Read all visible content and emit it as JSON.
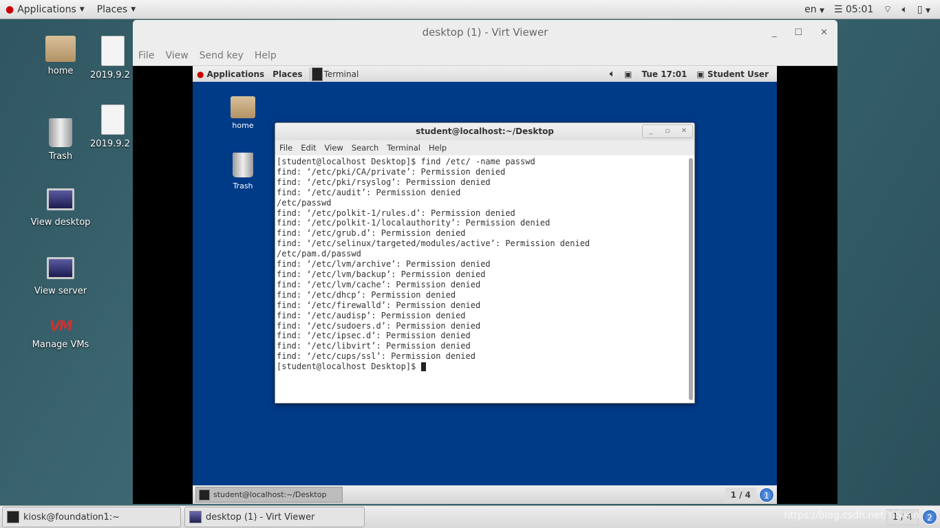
{
  "topbar": {
    "applications": "Applications",
    "places": "Places",
    "lang": "en",
    "time": "05:01"
  },
  "desktop_icons": [
    {
      "label": "home"
    },
    {
      "label": "2019.9.2"
    },
    {
      "label": "Trash"
    },
    {
      "label": "2019.9.2"
    },
    {
      "label": "View desktop"
    },
    {
      "label": "View server"
    },
    {
      "label": "Manage VMs",
      "logo": "VM"
    }
  ],
  "virt_viewer": {
    "title": "desktop (1) - Virt Viewer",
    "menu": [
      "File",
      "View",
      "Send key",
      "Help"
    ]
  },
  "vm": {
    "topbar": {
      "applications": "Applications",
      "places": "Places",
      "terminal": "Terminal",
      "time": "Tue 17:01",
      "user": "Student User"
    },
    "icons": [
      {
        "label": "home"
      },
      {
        "label": "Trash"
      }
    ],
    "terminal": {
      "title": "student@localhost:~/Desktop",
      "menu": [
        "File",
        "Edit",
        "View",
        "Search",
        "Terminal",
        "Help"
      ],
      "lines": [
        "[student@localhost Desktop]$ find /etc/ -name passwd",
        "find: ‘/etc/pki/CA/private’: Permission denied",
        "find: ‘/etc/pki/rsyslog’: Permission denied",
        "find: ‘/etc/audit’: Permission denied",
        "/etc/passwd",
        "find: ‘/etc/polkit-1/rules.d’: Permission denied",
        "find: ‘/etc/polkit-1/localauthority’: Permission denied",
        "find: ‘/etc/grub.d’: Permission denied",
        "find: ‘/etc/selinux/targeted/modules/active’: Permission denied",
        "/etc/pam.d/passwd",
        "find: ‘/etc/lvm/archive’: Permission denied",
        "find: ‘/etc/lvm/backup’: Permission denied",
        "find: ‘/etc/lvm/cache’: Permission denied",
        "find: ‘/etc/dhcp’: Permission denied",
        "find: ‘/etc/firewalld’: Permission denied",
        "find: ‘/etc/audisp’: Permission denied",
        "find: ‘/etc/sudoers.d’: Permission denied",
        "find: ‘/etc/ipsec.d’: Permission denied",
        "find: ‘/etc/libvirt’: Permission denied",
        "find: ‘/etc/cups/ssl’: Permission denied"
      ],
      "prompt": "[student@localhost Desktop]$ "
    },
    "taskbar": {
      "window": "student@localhost:~/Desktop",
      "workspace": "1 / 4",
      "badge": "1"
    }
  },
  "taskbar": {
    "items": [
      "kiosk@foundation1:~",
      "desktop (1) - Virt Viewer"
    ],
    "workspace": "1 / 4",
    "badge": "2"
  },
  "watermark": "https://blog.csdn.net/YiSean"
}
